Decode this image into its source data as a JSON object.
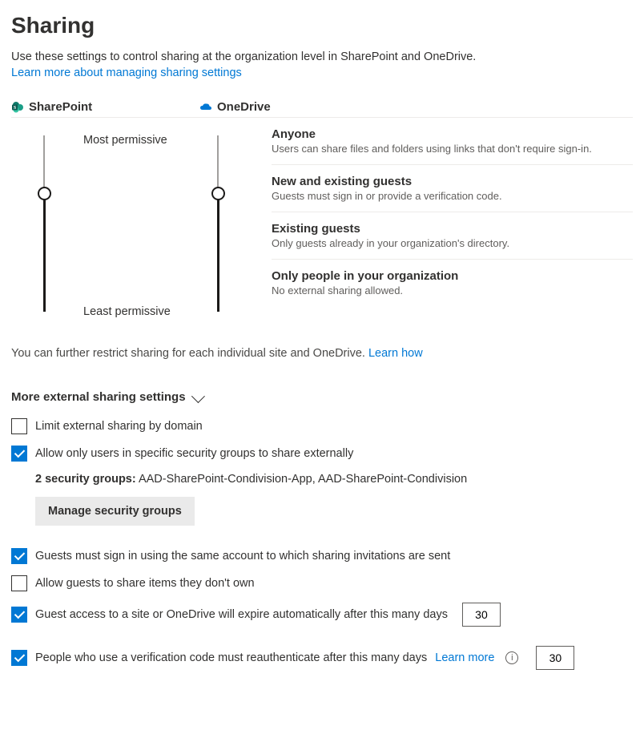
{
  "header": {
    "title": "Sharing",
    "intro": "Use these settings to control sharing at the organization level in SharePoint and OneDrive.",
    "learn_more": "Learn more about managing sharing settings"
  },
  "products": {
    "sharepoint": "SharePoint",
    "onedrive": "OneDrive"
  },
  "perm_labels": {
    "most": "Most permissive",
    "least": "Least permissive"
  },
  "levels": [
    {
      "title": "Anyone",
      "desc": "Users can share files and folders using links that don't require sign-in."
    },
    {
      "title": "New and existing guests",
      "desc": "Guests must sign in or provide a verification code."
    },
    {
      "title": "Existing guests",
      "desc": "Only guests already in your organization's directory."
    },
    {
      "title": "Only people in your organization",
      "desc": "No external sharing allowed."
    }
  ],
  "restrict_note": {
    "text": "You can further restrict sharing for each individual site and OneDrive. ",
    "link": "Learn how"
  },
  "more_section": {
    "title": "More external sharing settings"
  },
  "settings": {
    "limit_domain": {
      "label": "Limit external sharing by domain",
      "checked": false
    },
    "allow_groups": {
      "label": "Allow only users in specific security groups to share externally",
      "checked": true
    },
    "groups_count_label": "2 security groups:",
    "groups_list": "AAD-SharePoint-Condivision-App, AAD-SharePoint-Condivision",
    "manage_groups_btn": "Manage security groups",
    "guests_same_acct": {
      "label": "Guests must sign in using the same account to which sharing invitations are sent",
      "checked": true
    },
    "allow_guests_share": {
      "label": "Allow guests to share items they don't own",
      "checked": false
    },
    "guest_access_expire": {
      "label": "Guest access to a site or OneDrive will expire automatically after this many days",
      "checked": true,
      "value": "30"
    },
    "verification_reauth": {
      "label": "People who use a verification code must reauthenticate after this many days",
      "checked": true,
      "value": "30",
      "learn_more": "Learn more"
    }
  }
}
